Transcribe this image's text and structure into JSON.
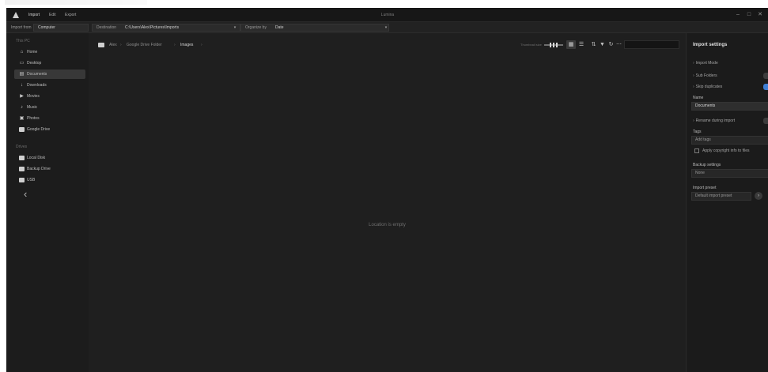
{
  "titlebar": {
    "tabs": [
      "Import",
      "Edit",
      "Export"
    ],
    "window_title": "Lumina",
    "controls": [
      "–",
      "□",
      "✕"
    ]
  },
  "toolbar": {
    "source_label": "Import from",
    "source_value": "Computer",
    "destination_label": "Destination",
    "destination_value": "C:\\Users\\Alex\\Pictures\\Imports",
    "organize_label": "Organize by",
    "organize_value": "Date"
  },
  "sidebar": {
    "sections": [
      {
        "header": "This PC",
        "items": [
          {
            "label": "Home",
            "icon": "home-icon",
            "glyph": "⌂"
          },
          {
            "label": "Desktop",
            "icon": "desktop-icon",
            "glyph": "▭"
          },
          {
            "label": "Documents",
            "icon": "documents-icon",
            "glyph": "▤",
            "active": true
          },
          {
            "label": "Downloads",
            "icon": "download-icon",
            "glyph": "↓"
          },
          {
            "label": "Movies",
            "icon": "movie-icon",
            "glyph": "▶"
          },
          {
            "label": "Music",
            "icon": "music-icon",
            "glyph": "♪"
          },
          {
            "label": "Photos",
            "icon": "photos-icon",
            "glyph": "▣"
          },
          {
            "label": "Google Drive",
            "icon": "folder-icon",
            "glyph": ""
          }
        ]
      },
      {
        "header": "Drives",
        "items": [
          {
            "label": "Local Disk",
            "icon": "folder-icon",
            "glyph": ""
          },
          {
            "label": "Backup Drive",
            "icon": "folder-icon",
            "glyph": ""
          },
          {
            "label": "USB",
            "icon": "folder-icon",
            "glyph": ""
          }
        ]
      }
    ],
    "back_glyph": "‹"
  },
  "main": {
    "breadcrumb": [
      "Alex",
      "Google Drive Folder",
      "Images"
    ],
    "breadcrumb_sep": "›",
    "thumbnail_size_label": "Thumbnail size",
    "view_modes": [
      "▦",
      "☰"
    ],
    "tools": [
      "⇅",
      "▼",
      "↻",
      "⋯"
    ],
    "empty_message": "Location is empty"
  },
  "panel": {
    "title": "Import settings",
    "sections": [
      "Import Mode",
      "Sub Folders",
      "Skip duplicates"
    ],
    "name_label": "Name",
    "name_value": "Documents",
    "rename_label": "Rename during import",
    "keywords_label": "Tags",
    "keywords_placeholder": "Add tags",
    "apply_label": "Apply copyright info to files",
    "backup_label": "Backup settings",
    "backup_placeholder": "None",
    "preset_label": "Import preset",
    "preset_value": "Default import preset"
  },
  "colors": {
    "accent": "#3f7fd6",
    "background": "#1f1f1f",
    "sidebar": "#1c1c1c",
    "active_item": "#383838"
  }
}
